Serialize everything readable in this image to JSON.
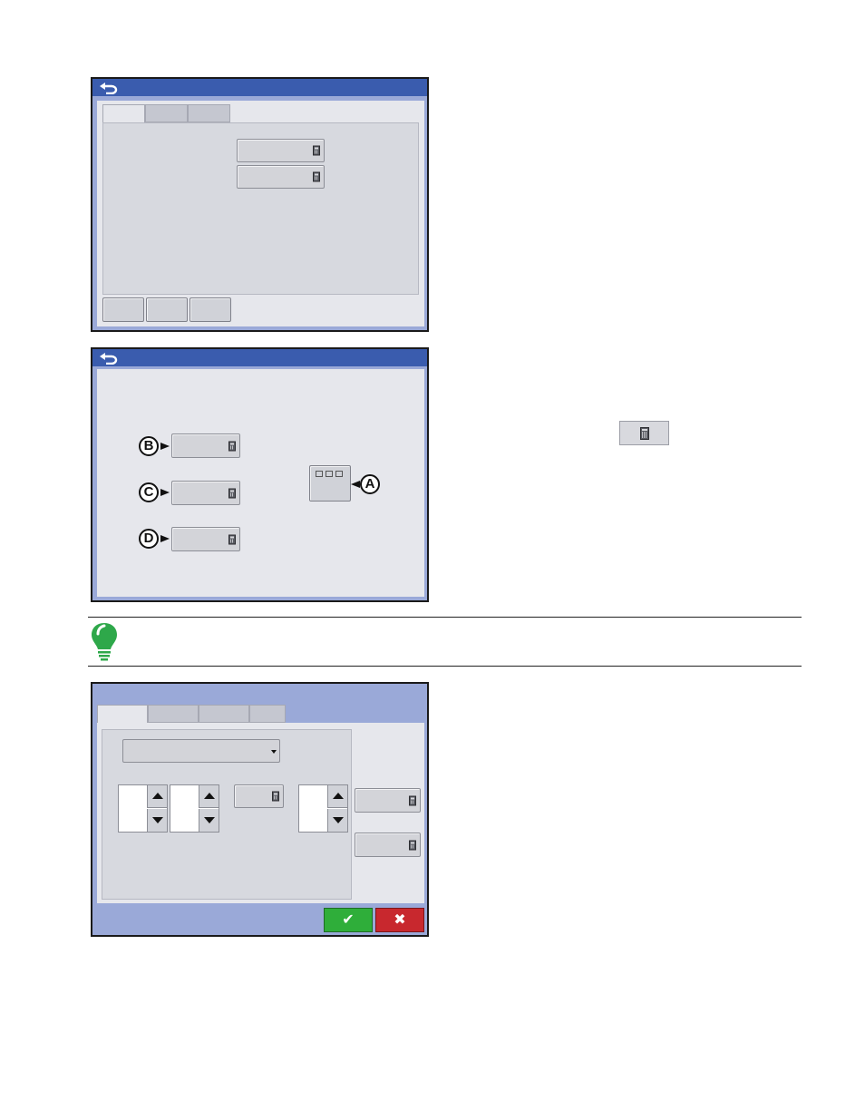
{
  "colors": {
    "title_bar": "#3a5cae",
    "frame": "#9aa9d8",
    "panel": "#e6e7ec",
    "ok_button": "#2fae3a",
    "cancel_button": "#c8282e",
    "tip_bulb": "#2ea84a"
  },
  "icons": {
    "back": "back-arrow-icon",
    "calculator": "calculator-icon",
    "ok": "checkmark-icon",
    "cancel": "x-icon",
    "tip": "lightbulb-icon"
  },
  "screen2": {
    "callouts": {
      "a": "A",
      "b": "B",
      "c": "C",
      "d": "D"
    }
  },
  "screen3": {
    "ok_glyph": "✔",
    "cancel_glyph": "✖"
  }
}
